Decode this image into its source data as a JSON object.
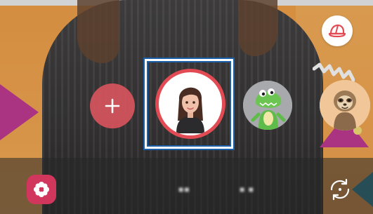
{
  "toolbar": {
    "add_emoji_icon": "plus-icon",
    "hat_icon": "hat-icon",
    "sticker_icon": "flower-icon",
    "switch_camera_icon": "switch-camera-icon"
  },
  "carousel": {
    "items": [
      {
        "name": "add",
        "icon": "plus-icon"
      },
      {
        "name": "my-emoji",
        "icon": "avatar-woman-icon",
        "selected": true
      },
      {
        "name": "crocodile",
        "icon": "crocodile-icon"
      },
      {
        "name": "sloth",
        "icon": "sloth-icon"
      }
    ]
  },
  "bottom_modes": {
    "labels": [
      "■■",
      "■ ■"
    ]
  },
  "colors": {
    "accent_red": "#e24b53",
    "selection_blue": "#1a5fa8",
    "sticker_pink": "#d1365c",
    "background_orange": "#f4a24a"
  }
}
